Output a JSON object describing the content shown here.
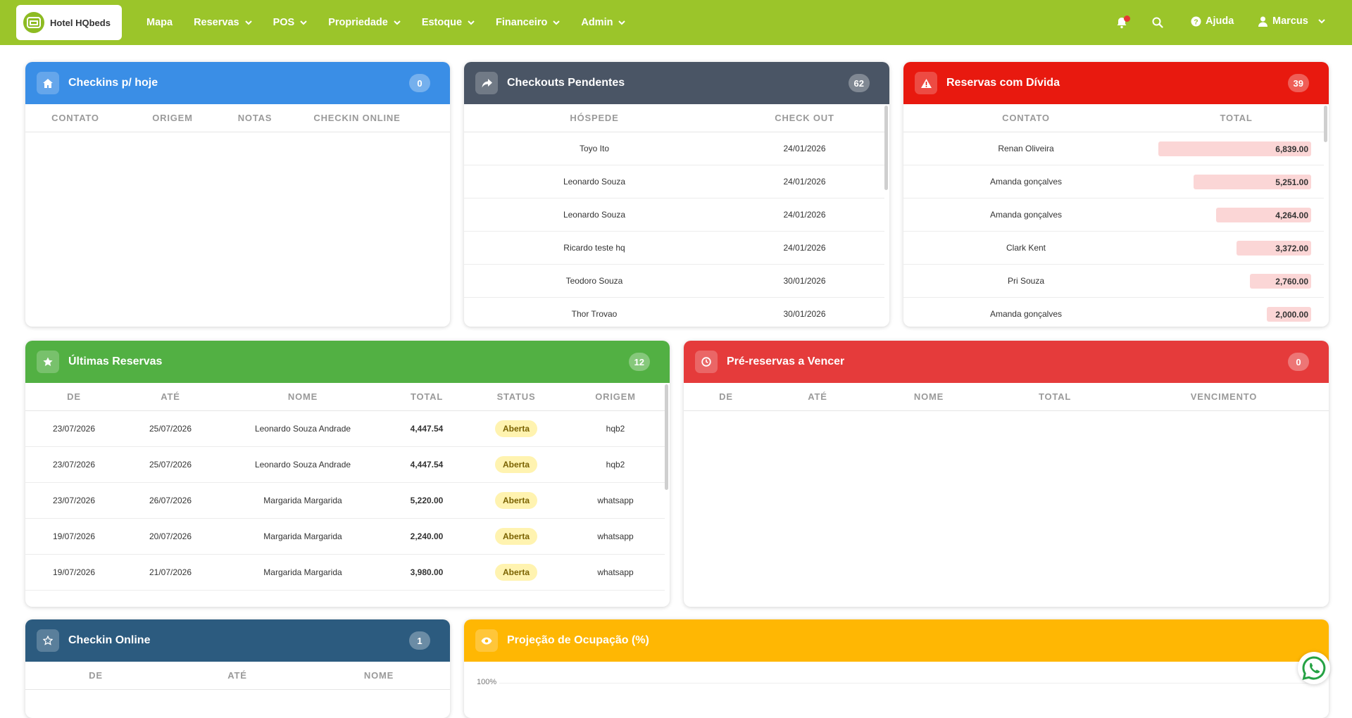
{
  "navbar": {
    "brand": "Hotel HQbeds",
    "menu": [
      {
        "label": "Mapa",
        "caret": false
      },
      {
        "label": "Reservas",
        "caret": true
      },
      {
        "label": "POS",
        "caret": true
      },
      {
        "label": "Propriedade",
        "caret": true
      },
      {
        "label": "Estoque",
        "caret": true
      },
      {
        "label": "Financeiro",
        "caret": true
      },
      {
        "label": "Admin",
        "caret": true
      }
    ],
    "help_label": "Ajuda",
    "user_label": "Marcus",
    "icons": [
      "bell-icon",
      "search-icon",
      "help-circle-icon",
      "user-icon"
    ]
  },
  "checkins": {
    "title": "Checkins p/ hoje",
    "count": "0",
    "color": "#3a8ee6",
    "icon": "home-icon",
    "columns": [
      "CONTATO",
      "ORIGEM",
      "NOTAS",
      "CHECKIN ONLINE"
    ]
  },
  "checkouts": {
    "title": "Checkouts Pendentes",
    "count": "62",
    "color": "#4a5565",
    "icon": "share-icon",
    "columns": [
      "HÓSPEDE",
      "CHECK OUT"
    ],
    "rows": [
      [
        "Toyo Ito",
        "24/01/2026"
      ],
      [
        "Leonardo Souza",
        "24/01/2026"
      ],
      [
        "Leonardo Souza",
        "24/01/2026"
      ],
      [
        "Ricardo teste hq",
        "24/01/2026"
      ],
      [
        "Teodoro Souza",
        "30/01/2026"
      ],
      [
        "Thor Trovao",
        "30/01/2026"
      ]
    ]
  },
  "debts": {
    "title": "Reservas com Dívida",
    "count": "39",
    "color": "#e8190f",
    "icon": "warning-icon",
    "columns": [
      "CONTATO",
      "TOTAL"
    ],
    "rows": [
      {
        "name": "Renan Oliveira",
        "total": "6,839.00",
        "fraction": 1.0
      },
      {
        "name": "Amanda gonçalves",
        "total": "5,251.00",
        "fraction": 0.77
      },
      {
        "name": "Amanda gonçalves",
        "total": "4,264.00",
        "fraction": 0.62
      },
      {
        "name": "Clark Kent",
        "total": "3,372.00",
        "fraction": 0.49
      },
      {
        "name": "Pri Souza",
        "total": "2,760.00",
        "fraction": 0.4
      },
      {
        "name": "Amanda gonçalves",
        "total": "2,000.00",
        "fraction": 0.29
      }
    ]
  },
  "ultimas": {
    "title": "Últimas Reservas",
    "count": "12",
    "color": "#52b043",
    "icon": "star-icon",
    "columns": [
      "DE",
      "ATÉ",
      "NOME",
      "TOTAL",
      "STATUS",
      "ORIGEM"
    ],
    "rows": [
      [
        "23/07/2026",
        "25/07/2026",
        "Leonardo Souza Andrade",
        "4,447.54",
        "Aberta",
        "hqb2"
      ],
      [
        "23/07/2026",
        "25/07/2026",
        "Leonardo Souza Andrade",
        "4,447.54",
        "Aberta",
        "hqb2"
      ],
      [
        "23/07/2026",
        "26/07/2026",
        "Margarida Margarida",
        "5,220.00",
        "Aberta",
        "whatsapp"
      ],
      [
        "19/07/2026",
        "20/07/2026",
        "Margarida Margarida",
        "2,240.00",
        "Aberta",
        "whatsapp"
      ],
      [
        "19/07/2026",
        "21/07/2026",
        "Margarida Margarida",
        "3,980.00",
        "Aberta",
        "whatsapp"
      ]
    ]
  },
  "prereservas": {
    "title": "Pré-reservas a Vencer",
    "count": "0",
    "color": "#e53b3b",
    "icon": "clock-icon",
    "columns": [
      "DE",
      "ATÉ",
      "NOME",
      "TOTAL",
      "VENCIMENTO"
    ]
  },
  "checkin_online": {
    "title": "Checkin Online",
    "count": "1",
    "color": "#2c5b7f",
    "icon": "star-outline-icon",
    "columns": [
      "DE",
      "ATÉ",
      "NOME"
    ]
  },
  "projecao": {
    "title": "Projeção de Ocupação (%)",
    "color": "#ffb703",
    "icon": "eye-icon",
    "y_tick": "100%"
  }
}
